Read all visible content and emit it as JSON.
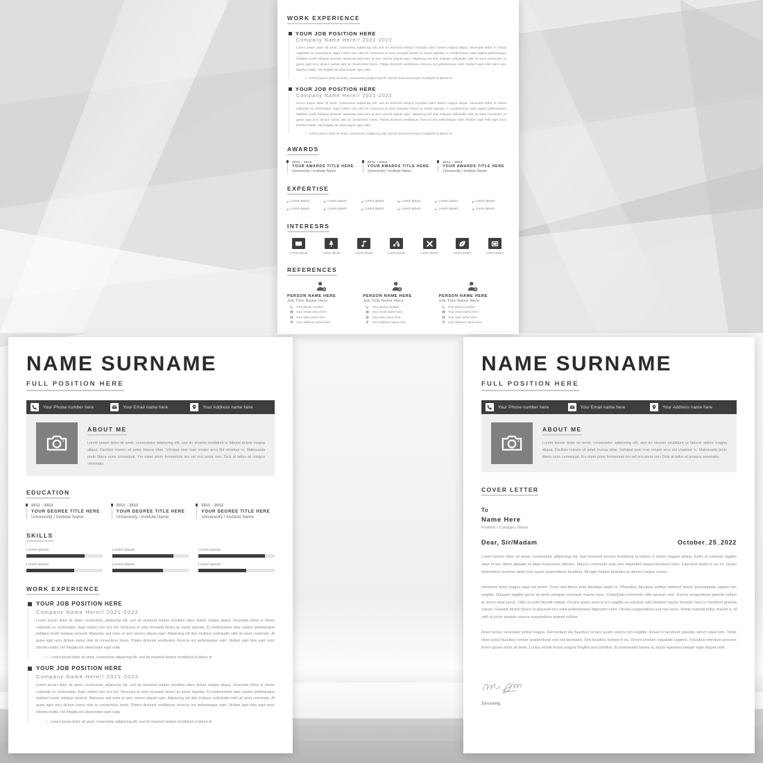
{
  "background": {
    "base_color": "#f2f2f2",
    "tone_light": "#fafafa",
    "tone_mid": "#e6e6e6",
    "tone_dark": "#d4d4d4"
  },
  "theme": {
    "ink": "#2b2b2b",
    "muted": "#8a8a8a",
    "dark_bar": "#3d3d3d",
    "panel": "#efefef",
    "track": "#e4e4e4",
    "photo": "#808080"
  },
  "lorem": {
    "experience_paragraph": "Lorem ipsum dolor sit amet, consectetur adipiscing elit, sed do eiusmod tempor incrdidur labor dolore magna aliqua. Venenatis tellus in metus vulputate eu scelerisque. Eget nullam non nisi est. Senectus et netu mrsuada fames ac turpis egestas. A condimentum vitae sapien pellentesque habitant morbi tristique senectit. Maeenas sed enim ut sem viverra aliquet eget. Adipiscing elit duis tristique sollicitudin nibh sit amet commodo. At guew eget arcu dictum varius duis at consectetur lorem. Platea dictumst vestibulum rhoncus est pellentesque ealrt. Nullam eget felis eget nunc lobortis mattis. Vel fringilla est ullamcorper eget nulla",
    "experience_bullet": "Lorem ipsum dolor sit amet, consectetur adipiscing elit, sed do eiusmod tempor incididunt ut labore et",
    "about_paragraph": "Lorem ipsum dolor sit amet, consectetur adipiscing elit, sed do eiusmo incididunt ut laborei dolore magna aliqua. Facilisis mauris sit amet massa vitae. Volutpat seai cras ornare arcu dui vivamus rs. Malesuada proin libero nunc consequat. Frs mper prom fermentum leo vel orci porta non. Duis at tellus at umayra venenatis.",
    "item_label": "Lorem ipsum"
  },
  "top_sheet": {
    "work_experience": {
      "heading": "WORK EXPERIENCE",
      "entries": [
        {
          "title": "YOUR JOB POSITION HERE",
          "company": "Company Name Here// 2021-2022"
        },
        {
          "title": "YOUR JOB POSITION HERE",
          "company": "Company Name Here// 2021-2022"
        }
      ]
    },
    "awards": {
      "heading": "AWARDS",
      "items": [
        {
          "years": "2011 - 2012",
          "title": "YOUR AWARDS TITLE HERE",
          "school": "Univeresity / Institute Name"
        },
        {
          "years": "2011 - 2012",
          "title": "YOUR AWARDS TITLE HERE",
          "school": "Univeresity / Institute Name"
        },
        {
          "years": "2011 - 2012",
          "title": "YOUR AWARDS TITLE HERE",
          "school": "Univeresity / Institute Name"
        }
      ]
    },
    "expertise": {
      "heading": "EXPERTISE",
      "items": [
        "Lorem ipsum",
        "Lorem ipsum",
        "Lorem ipsum",
        "Lorem ipsum",
        "Lorem ipsum",
        "Lorem ipsum",
        "Lorem ipsum",
        "Lorem ipsum",
        "Lorem ipsum",
        "Lorem ipsum",
        "Lorem ipsum",
        "Lorem ipsum"
      ]
    },
    "interests": {
      "heading": "INTERESRS",
      "items": [
        {
          "icon": "book-icon",
          "label": "Lorem ipsum"
        },
        {
          "icon": "tree-icon",
          "label": "Lorem ipsum"
        },
        {
          "icon": "music-note-icon",
          "label": "Lorem ipsum"
        },
        {
          "icon": "bicycle-icon",
          "label": "Lorem ipsum"
        },
        {
          "icon": "crossed-tools-icon",
          "label": "Lorem ipsum"
        },
        {
          "icon": "football-icon",
          "label": "Lorem ipsum"
        },
        {
          "icon": "photo-film-icon",
          "label": "Lorem ipsum"
        }
      ]
    },
    "references": {
      "heading": "REFERENCES",
      "items": [
        {
          "name": "PERSON NAME HERE",
          "job": "Job Title Name Here",
          "phone": "Your phone number",
          "email": "Your email name here",
          "web": "Your web name here",
          "address": "Your address name here"
        },
        {
          "name": "PERSON NAME HERE",
          "job": "Job Title Name Here",
          "phone": "Your phone number",
          "email": "Your email name here",
          "web": "Your web name here",
          "address": "Your address name here"
        },
        {
          "name": "PERSON NAME HERE",
          "job": "Job Title Name Here",
          "phone": "Your phone number",
          "email": "Your email name here",
          "web": "Your web name here",
          "address": "Your address name here"
        }
      ]
    }
  },
  "resume_page": {
    "name": "NAME SURNAME",
    "position": "FULL POSITION HERE",
    "contact": [
      {
        "icon": "phone-icon",
        "text": "Your Phone number here"
      },
      {
        "icon": "mail-icon",
        "text": "Your Email name here"
      },
      {
        "icon": "location-pin-icon",
        "text": "Your Address name here"
      }
    ],
    "about": {
      "heading": "ABOUT ME",
      "photo_icon": "camera-icon"
    },
    "education": {
      "heading": "EDUCATION",
      "items": [
        {
          "years": "2011 - 2012",
          "title": "YOUR DEGREE TITLE HERE",
          "school": "Univeresity / Institute Name"
        },
        {
          "years": "2011 - 2012",
          "title": "YOUR DEGREE TITLE HERE",
          "school": "Univeresity / Institute Name"
        },
        {
          "years": "2011 - 2012",
          "title": "YOUR DEGREE TITLE HERE",
          "school": "Univeresity / Institute Name"
        }
      ]
    },
    "skills": {
      "heading": "SKILLS",
      "items": [
        {
          "label": "Lorem ipsum",
          "percent": 76
        },
        {
          "label": "Lorem ipsum",
          "percent": 80
        },
        {
          "label": "Lorem ipsum",
          "percent": 87
        },
        {
          "label": "Lorem ipsum",
          "percent": 63
        },
        {
          "label": "Lorem ipsum",
          "percent": 66
        },
        {
          "label": "Lorem ipsum",
          "percent": 63
        }
      ]
    },
    "work_experience": {
      "heading": "WORK EXPERIENCE",
      "entries": [
        {
          "title": "YOUR JOB POSITION HERE",
          "company": "Company Name Here// 2021-2022"
        },
        {
          "title": "YOUR JOB POSITION HERE",
          "company": "Company Name Here// 2021-2022"
        }
      ]
    }
  },
  "cover_page": {
    "name": "NAME SURNAME",
    "position": "FULL POSITION HERE",
    "contact": [
      {
        "icon": "phone-icon",
        "text": "Your Phone number here"
      },
      {
        "icon": "mail-icon",
        "text": "Your Email name here"
      },
      {
        "icon": "location-pin-icon",
        "text": "Your Address name here"
      }
    ],
    "about": {
      "heading": "ABOUT ME",
      "photo_icon": "camera-icon"
    },
    "cover_letter": {
      "heading": "COVER LETTER",
      "to_label": "To",
      "recipient_name": "Name Here",
      "recipient_position": "Position / Company Name",
      "salutation": "Dear, Sir/Madam",
      "date": "October_25_2022",
      "paragraphs": [
        "Lorem ipsum dolor sit amet, consectetur adipiscing elit, sed eiusmod tempor incididunt ut labore rt dolore magna aliqua. Enim ut mentum sagittis vitae et leo. Amet aliquam id diam maecenas ultricies. Maurrs commodo quis arer imperdiet massa tincidunt nunc. Faucibus turpis in eu mi. Quam elementum pulvinar etiam non quaei suspendisse faucibus. Mi eget mauris pharetra et ultrices neque ornare.",
        "Hendrerit dolor magna eget est lorem. Proin sed libero enm faucibus turpis in. Phasellus faucibus sceliue eleifend donec prevulputate sapien nec sagittis. Quisque sagittis purus sit amet volutpat conequat mauris nunc. CeturiQuis commodo odio aenean sed. Viverra suspendisse potenti nullam ac tortor vitae purus. Odio ut enim blandit voltpat. Ornare quam viverra orci sagittis eu volutpat odio facilisis mauris.Semper risus in hendrerit gravida rutrum. Gravida dictum fusce ut placerat orci nulla pellentesque dignissim enim. Ornare suspendisse sed nisi lacus. Nirtae suscipit tellus mauris a. Id velit ut tortor pretium viverra suspendisse potenti nullam.",
        "Amet luctus venenatis lectus magna. Fermentum dui faucibus ornare quam viverra orci sagittis. Rrsus in hendrerit gravida rutrum sque non. Tortor vitae purus faucibus ornare suspendisse sed nisi lacrissed. Sed faucibus tuerpis in eu. Donec pretium vulputate sapienc. Faucibus interdum posuere lorem ipsum dolor sit amet. Luctus venati lectus magna fringilla uma porttitor. Et malesuada fames ac turpis egesteas integer eget aliquet nibh."
      ],
      "signature_text": "Name Surname",
      "closing": "Sincerely,"
    }
  }
}
